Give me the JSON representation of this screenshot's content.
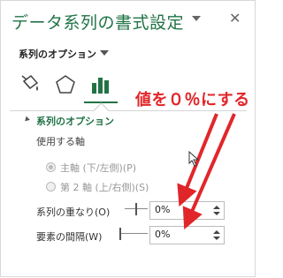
{
  "header": {
    "title": "データ系列の書式設定",
    "close_glyph": "✕"
  },
  "options_menu": {
    "label": "系列のオプション"
  },
  "tabs": [
    {
      "name": "fill-line",
      "icon": "paint-bucket-icon"
    },
    {
      "name": "effects",
      "icon": "pentagon-icon"
    },
    {
      "name": "series-options",
      "icon": "bar-chart-icon",
      "active": true
    }
  ],
  "section": {
    "title": "系列のオプション",
    "axis_label": "使用する軸",
    "radios": [
      {
        "label": "主軸 (下/左側)(P)",
        "checked": true
      },
      {
        "label": "第 2 軸 (上/右側)(S)",
        "checked": false
      }
    ],
    "overlap": {
      "label": "系列の重なり(O)",
      "value": "0%",
      "level": 0.5
    },
    "gap_width": {
      "label": "要素の間隔(W)",
      "value": "0%",
      "level": 0.0
    }
  },
  "annotation": {
    "text": "値を０％にする",
    "color": "#e1262a"
  },
  "colors": {
    "accent": "#217346"
  }
}
